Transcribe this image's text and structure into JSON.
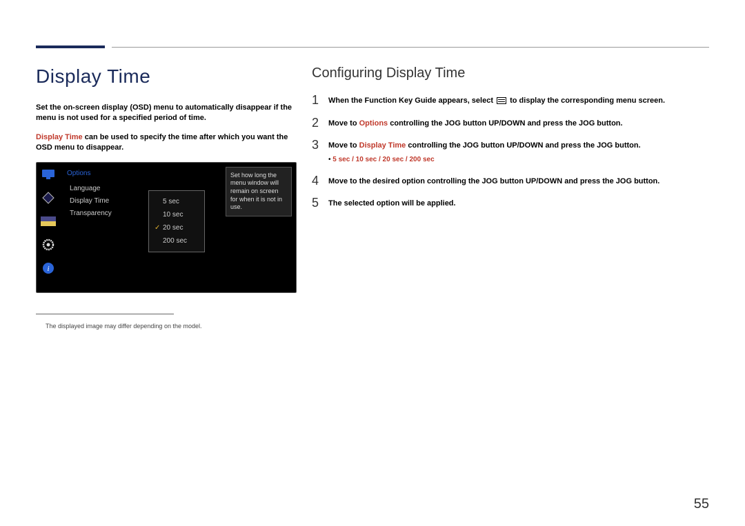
{
  "page": {
    "number": "55"
  },
  "left": {
    "heading": "Display Time",
    "intro1_a": "Set the on-screen display (OSD) menu to automatically disappear if the menu is not used for a specified period of time.",
    "intro2_hl": "Display Time",
    "intro2_b": " can be used to specify the time after which you want the OSD menu to disappear.",
    "footnote": "The displayed image may differ depending on the model."
  },
  "osd": {
    "title": "Options",
    "items": [
      "Language",
      "Display Time",
      "Transparency"
    ],
    "dropdown": [
      "5 sec",
      "10 sec",
      "20 sec",
      "200 sec"
    ],
    "selected_index": 2,
    "tooltip": "Set how long the menu window will remain on screen for when it is not in use."
  },
  "right": {
    "heading": "Configuring Display Time",
    "steps": {
      "1": {
        "text_a": "When the Function Key Guide appears, select ",
        "text_b": " to display the corresponding menu screen."
      },
      "2": {
        "text_a": "Move to ",
        "hl": "Options",
        "text_b": " controlling the JOG button UP/DOWN and press the JOG button."
      },
      "3": {
        "text_a": "Move to ",
        "hl": "Display Time",
        "text_b": " controlling the JOG button UP/DOWN and press the JOG button.",
        "sub_options": "5 sec / 10 sec / 20 sec / 200 sec"
      },
      "4": {
        "text": "Move to the desired option controlling the JOG button UP/DOWN and press the JOG button."
      },
      "5": {
        "text": "The selected option will be applied."
      }
    }
  }
}
